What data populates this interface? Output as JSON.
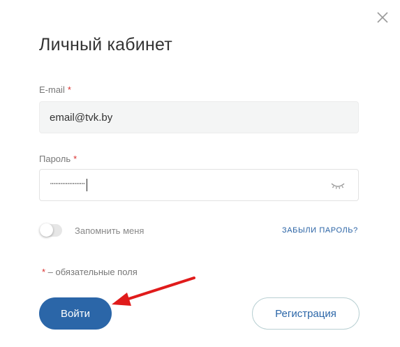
{
  "modal": {
    "title": "Личный кабинет",
    "close_icon": "close-icon"
  },
  "email": {
    "label": "E-mail",
    "required_mark": "*",
    "value": "email@tvk.by"
  },
  "password": {
    "label": "Пароль",
    "required_mark": "*",
    "masked_value": "····················",
    "toggle_icon": "eye-closed-icon"
  },
  "remember": {
    "label": "Запомнить меня",
    "checked": false
  },
  "forgot_link": "ЗАБЫЛИ ПАРОЛЬ?",
  "required_note": {
    "mark": "*",
    "text": " – обязательные поля"
  },
  "buttons": {
    "login": "Войти",
    "register": "Регистрация"
  },
  "colors": {
    "primary": "#2b66a8",
    "required": "#d9302f",
    "arrow": "#e01b1b"
  }
}
